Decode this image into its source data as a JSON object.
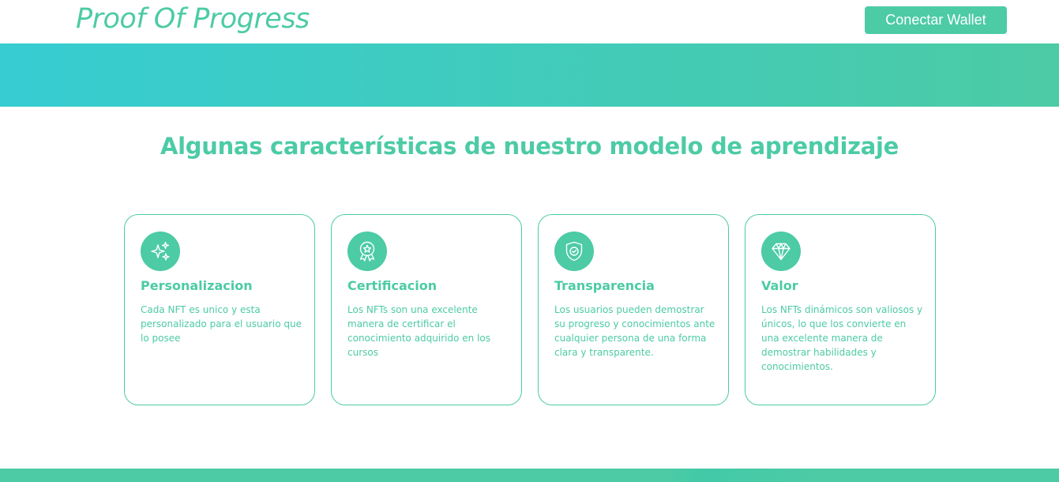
{
  "header": {
    "logo": "Proof Of Progress",
    "wallet_button": "Conectar Wallet"
  },
  "section": {
    "title": "Algunas características de nuestro modelo de aprendizaje"
  },
  "cards": [
    {
      "icon": "sparkles-icon",
      "title": "Personalizacion",
      "description": "Cada NFT es unico y esta personalizado para el usuario que lo posee"
    },
    {
      "icon": "award-badge-icon",
      "title": "Certificacion",
      "description": "Los NFTs son una excelente manera de certificar el conocimiento adquirido en los cursos"
    },
    {
      "icon": "shield-check-icon",
      "title": "Transparencia",
      "description": "Los usuarios pueden demostrar su progreso y conocimientos ante cualquier persona de una forma clara y transparente."
    },
    {
      "icon": "diamond-icon",
      "title": "Valor",
      "description": "Los NFTs dinámicos son valiosos y únicos, lo que los convierte en una excelente manera de demostrar habilidades y conocimientos."
    }
  ],
  "colors": {
    "accent": "#4ccba5",
    "banner_start": "#36ccd2",
    "banner_end": "#4ccba5",
    "background": "#ffffff"
  }
}
